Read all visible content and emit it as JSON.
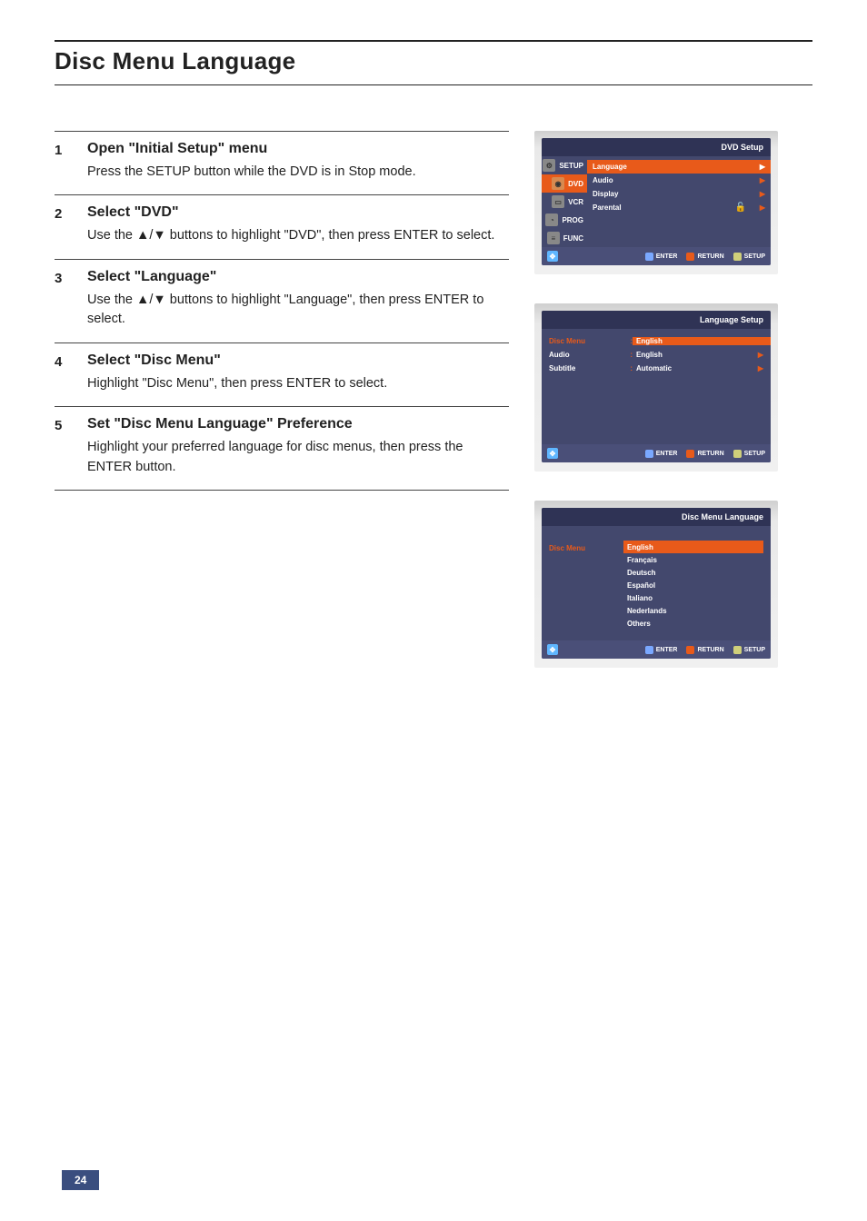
{
  "page": {
    "title": "Disc Menu Language",
    "page_number": "24"
  },
  "steps": [
    {
      "num": "1",
      "heading": "Open \"Initial Setup\" menu",
      "desc": "Press the SETUP button while the DVD is in Stop mode."
    },
    {
      "num": "2",
      "heading": "Select \"DVD\"",
      "desc": "Use the ▲/▼ buttons to highlight \"DVD\", then press ENTER to select."
    },
    {
      "num": "3",
      "heading": "Select \"Language\"",
      "desc": "Use the ▲/▼ buttons to highlight \"Language\", then press ENTER to select."
    },
    {
      "num": "4",
      "heading": "Select \"Disc Menu\"",
      "desc": "Highlight \"Disc Menu\", then press ENTER to select."
    },
    {
      "num": "5",
      "heading": "Set \"Disc Menu Language\" Preference",
      "desc": "Highlight your preferred language for disc menus, then press the ENTER button."
    }
  ],
  "screen1": {
    "title": "DVD Setup",
    "nav": [
      {
        "label": "SETUP",
        "selected": false,
        "icon": "gear"
      },
      {
        "label": "DVD",
        "selected": true,
        "icon": "disc"
      },
      {
        "label": "VCR",
        "selected": false,
        "icon": "tape"
      },
      {
        "label": "PROG",
        "selected": false,
        "icon": "clock"
      },
      {
        "label": "FUNC",
        "selected": false,
        "icon": "bars"
      }
    ],
    "items": [
      {
        "label": "Language",
        "selected": true,
        "icon": ""
      },
      {
        "label": "Audio",
        "selected": false,
        "icon": ""
      },
      {
        "label": "Display",
        "selected": false,
        "icon": ""
      },
      {
        "label": "Parental",
        "selected": false,
        "icon": "lock"
      }
    ],
    "footer": {
      "move": "+",
      "enter": "ENTER",
      "ret": "RETURN",
      "setup": "SETUP"
    }
  },
  "screen2": {
    "title": "Language Setup",
    "rows": [
      {
        "label": "Disc Menu",
        "value": "English",
        "selected": true
      },
      {
        "label": "Audio",
        "value": "English",
        "selected": false
      },
      {
        "label": "Subtitle",
        "value": "Automatic",
        "selected": false
      }
    ],
    "footer": {
      "enter": "ENTER",
      "ret": "RETURN",
      "setup": "SETUP"
    }
  },
  "screen3": {
    "title": "Disc Menu Language",
    "left_label": "Disc Menu",
    "options": [
      {
        "label": "English",
        "selected": true
      },
      {
        "label": "Français",
        "selected": false
      },
      {
        "label": "Deutsch",
        "selected": false
      },
      {
        "label": "Español",
        "selected": false
      },
      {
        "label": "Italiano",
        "selected": false
      },
      {
        "label": "Nederlands",
        "selected": false
      },
      {
        "label": "Others",
        "selected": false
      }
    ],
    "footer": {
      "enter": "ENTER",
      "ret": "RETURN",
      "setup": "SETUP"
    }
  }
}
